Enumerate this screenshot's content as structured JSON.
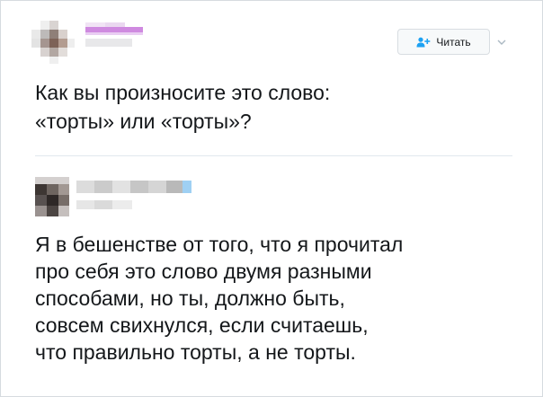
{
  "tweet": {
    "follow_button_label": "Читать",
    "text_line1": "Как вы произносите это слово:",
    "text_line2": "«торты» или «торты»?"
  },
  "reply": {
    "text_lines": [
      "Я в бешенстве от того, что я прочитал",
      "про себя это слово двумя разными",
      "способами, но ты, должно быть,",
      "совсем свихнулся, если считаешь,",
      "что правильно торты, а не торты."
    ]
  },
  "icons": {
    "follow": "add-user-icon",
    "more": "chevron-down-icon"
  },
  "colors": {
    "accent": "#1da1f2",
    "text": "#14171a",
    "border": "#e1e8ed",
    "blurred_name": "#c77bdc"
  }
}
